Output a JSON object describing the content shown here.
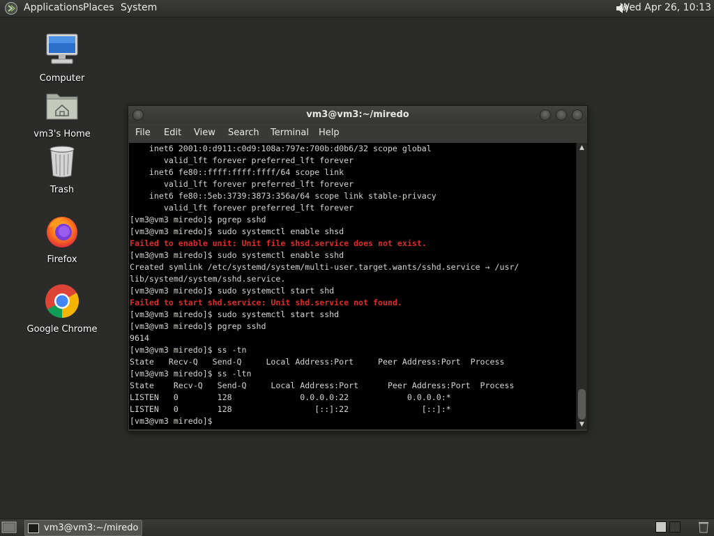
{
  "top_panel": {
    "menus": [
      "Applications",
      "Places",
      "System"
    ],
    "clock": "Wed Apr 26, 10:13"
  },
  "desktop": {
    "icons": [
      {
        "label": "Computer"
      },
      {
        "label": "vm3's Home"
      },
      {
        "label": "Trash"
      },
      {
        "label": "Firefox"
      },
      {
        "label": "Google Chrome"
      }
    ]
  },
  "terminal": {
    "title": "vm3@vm3:~/miredo",
    "menu": [
      "File",
      "Edit",
      "View",
      "Search",
      "Terminal",
      "Help"
    ],
    "lines": [
      {
        "text": "    inet6 2001:0:d911:c0d9:108a:797e:700b:d0b6/32 scope global",
        "error": false
      },
      {
        "text": "       valid_lft forever preferred_lft forever",
        "error": false
      },
      {
        "text": "    inet6 fe80::ffff:ffff:ffff/64 scope link",
        "error": false
      },
      {
        "text": "       valid_lft forever preferred_lft forever",
        "error": false
      },
      {
        "text": "    inet6 fe80::5eb:3739:3873:356a/64 scope link stable-privacy",
        "error": false
      },
      {
        "text": "       valid_lft forever preferred_lft forever",
        "error": false
      },
      {
        "text": "[vm3@vm3 miredo]$ pgrep sshd",
        "error": false
      },
      {
        "text": "[vm3@vm3 miredo]$ sudo systemctl enable shsd",
        "error": false
      },
      {
        "text": "Failed to enable unit: Unit file shsd.service does not exist.",
        "error": true
      },
      {
        "text": "[vm3@vm3 miredo]$ sudo systemctl enable sshd",
        "error": false
      },
      {
        "text": "Created symlink /etc/systemd/system/multi-user.target.wants/sshd.service → /usr/",
        "error": false
      },
      {
        "text": "lib/systemd/system/sshd.service.",
        "error": false
      },
      {
        "text": "[vm3@vm3 miredo]$ sudo systemctl start shd",
        "error": false
      },
      {
        "text": "Failed to start shd.service: Unit shd.service not found.",
        "error": true
      },
      {
        "text": "[vm3@vm3 miredo]$ sudo systemctl start sshd",
        "error": false
      },
      {
        "text": "[vm3@vm3 miredo]$ pgrep sshd",
        "error": false
      },
      {
        "text": "9614",
        "error": false
      },
      {
        "text": "[vm3@vm3 miredo]$ ss -tn",
        "error": false
      },
      {
        "text": "State   Recv-Q   Send-Q     Local Address:Port     Peer Address:Port  Process",
        "error": false
      },
      {
        "text": "[vm3@vm3 miredo]$ ss -ltn",
        "error": false
      },
      {
        "text": "State    Recv-Q   Send-Q     Local Address:Port      Peer Address:Port  Process",
        "error": false
      },
      {
        "text": "LISTEN   0        128              0.0.0.0:22            0.0.0.0:*",
        "error": false
      },
      {
        "text": "LISTEN   0        128                 [::]:22               [::]:*",
        "error": false
      },
      {
        "text": "[vm3@vm3 miredo]$ ",
        "error": false
      }
    ]
  },
  "taskbar": {
    "task_label": "vm3@vm3:~/miredo"
  },
  "colors": {
    "error_text": "#e02a2a",
    "terminal_bg": "#000000",
    "terminal_fg": "#d3d7cf"
  }
}
